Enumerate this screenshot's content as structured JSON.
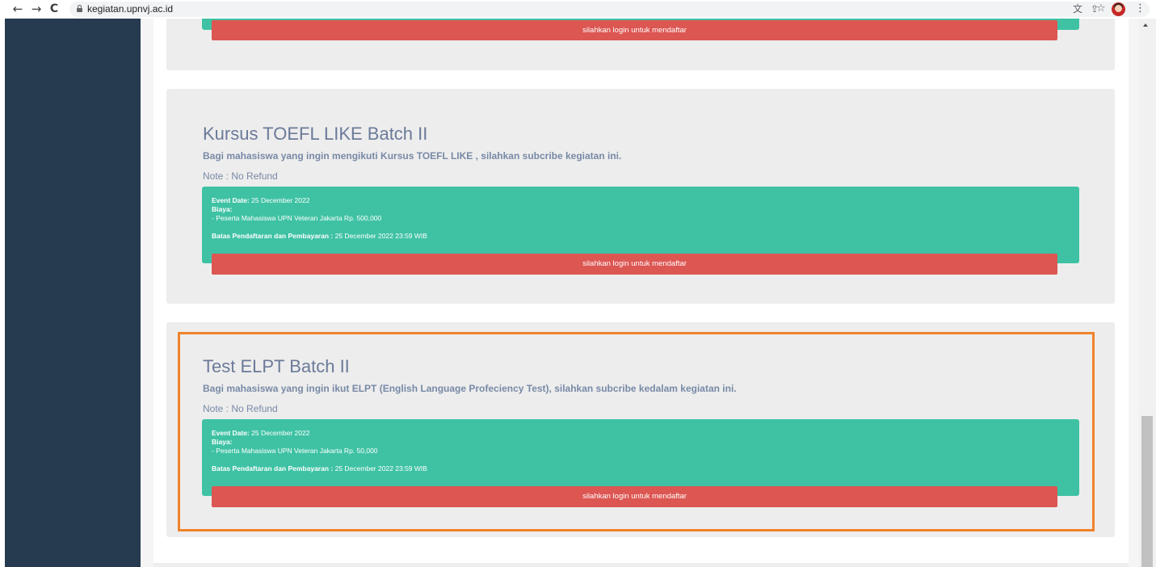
{
  "browser": {
    "url": "kegiatan.upnvj.ac.id",
    "back_glyph": "←",
    "forward_glyph": "→",
    "reload_glyph": "C",
    "menu_glyph": "⋮",
    "star_glyph": "☆",
    "share_glyph": "⇪",
    "translate_glyph": "文"
  },
  "icons": [
    "back-arrow-icon",
    "forward-arrow-icon",
    "reload-icon",
    "lock-icon",
    "translate-icon",
    "share-icon",
    "star-icon",
    "avatar",
    "menu-icon"
  ],
  "colors": {
    "sidebar": "#263a50",
    "card_bg": "#ededed",
    "info_bg": "#3fc2a4",
    "button_bg": "#dc5652",
    "highlight": "#f0822a",
    "title_text": "#6b7a99"
  },
  "cards": [
    {
      "button_label": "silahkan login untuk mendaftar"
    },
    {
      "title": "Kursus TOEFL LIKE Batch II",
      "description": "Bagi mahasiswa yang  ingin mengikuti Kursus TOEFL LIKE , silahkan subcribe kegiatan ini.",
      "note": "Note : No Refund",
      "event_date_label": "Event Date:",
      "event_date": " 25 December 2022",
      "biaya_label": "Biaya:",
      "fee_line": "- Peserta Mahasiswa UPN Veteran Jakarta Rp. 500,000",
      "deadline_label": "Batas Pendaftaran dan Pembayaran :",
      "deadline": " 25 December 2022 23:59 WIB",
      "button_label": "silahkan login untuk mendaftar"
    },
    {
      "title": "Test ELPT Batch II",
      "description": "Bagi mahasiswa yang ingin ikut ELPT (English Language Profeciency Test), silahkan subcribe kedalam kegiatan ini.",
      "note": "Note : No Refund",
      "event_date_label": "Event Date:",
      "event_date": " 25 December 2022",
      "biaya_label": "Biaya:",
      "fee_line": "- Peserta Mahasiswa UPN Veteran Jakarta Rp. 50,000",
      "deadline_label": "Batas Pendaftaran dan Pembayaran :",
      "deadline": " 25 December 2022 23:59 WIB",
      "button_label": "silahkan login untuk mendaftar"
    }
  ]
}
